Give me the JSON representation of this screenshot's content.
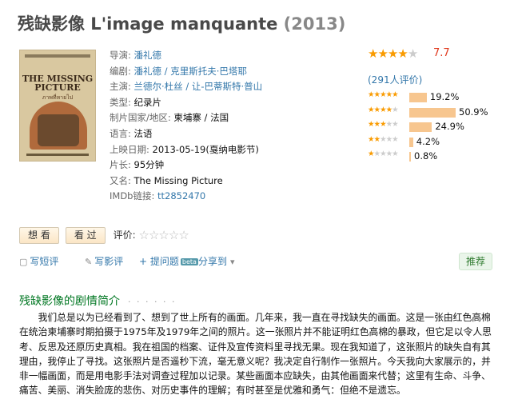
{
  "movie": {
    "title": "残缺影像 L'image manquante",
    "year": "(2013)"
  },
  "poster": {
    "title_line": "THE MISSING PICTURE",
    "sub": "ภาพที่หายไป"
  },
  "info": [
    {
      "label": "导演:",
      "value": "潘礼德",
      "link": true
    },
    {
      "label": "编剧:",
      "value": "潘礼德 / 克里斯托夫·巴塔耶",
      "link": true
    },
    {
      "label": "主演:",
      "value": "兰德尔·杜丝 / 让-巴蒂斯特·普山",
      "link": true
    },
    {
      "label": "类型:",
      "value": "纪录片",
      "link": false
    },
    {
      "label": "制片国家/地区:",
      "value": "柬埔寨 / 法国",
      "link": false
    },
    {
      "label": "语言:",
      "value": "法语",
      "link": false
    },
    {
      "label": "上映日期:",
      "value": "2013-05-19(戛纳电影节)",
      "link": false
    },
    {
      "label": "片长:",
      "value": "95分钟",
      "link": false
    },
    {
      "label": "又名:",
      "value": "The Missing Picture",
      "link": false
    },
    {
      "label": "IMDb链接:",
      "value": "tt2852470",
      "link": true
    }
  ],
  "rating": {
    "score": "7.7",
    "stars_filled": 4,
    "votes_text": "(291人评价)",
    "accent_color": "#f99b01",
    "distribution": [
      {
        "stars": 5,
        "percent": 19.2,
        "label": "19.2%"
      },
      {
        "stars": 4,
        "percent": 50.9,
        "label": "50.9%"
      },
      {
        "stars": 3,
        "percent": 24.9,
        "label": "24.9%"
      },
      {
        "stars": 2,
        "percent": 4.2,
        "label": "4.2%"
      },
      {
        "stars": 1,
        "percent": 0.8,
        "label": "0.8%"
      }
    ]
  },
  "actions": {
    "want_label": "想 看",
    "seen_label": "看 过",
    "rate_label": "评价:"
  },
  "tools": {
    "write_short": "写短评",
    "write_review": "写影评",
    "ask": "+ 提问题",
    "beta": "beta",
    "share": "分享到",
    "recommend": "推荐"
  },
  "intro": {
    "heading": "残缺影像的剧情简介",
    "dots": "· · · · · ·",
    "text": "我们总是以为已经看到了、想到了世上所有的画面。几年来，我一直在寻找缺失的画面。这是一张由红色高棉在统治柬埔寨时期拍摄于1975年及1979年之间的照片。这一张照片并不能证明红色高棉的暴政，但它足以令人思考、反思及还原历史真相。我在祖国的档案、证件及宣传资料里寻找无果。现在我知道了，这张照片的缺失自有其理由，我停止了寻找。这张照片是否遥秒下流，毫无意义呢？我决定自行制作一张照片。今天我向大家展示的，并非一幅画面，而是用电影手法对调查过程加以记录。某些画面本应缺失，由其他画面来代替；这里有生命、斗争、痛苦、美丽、消失脸庞的悲伤、对历史事件的理解；有时甚至是优雅和勇气：但绝不是遗忘。"
  }
}
